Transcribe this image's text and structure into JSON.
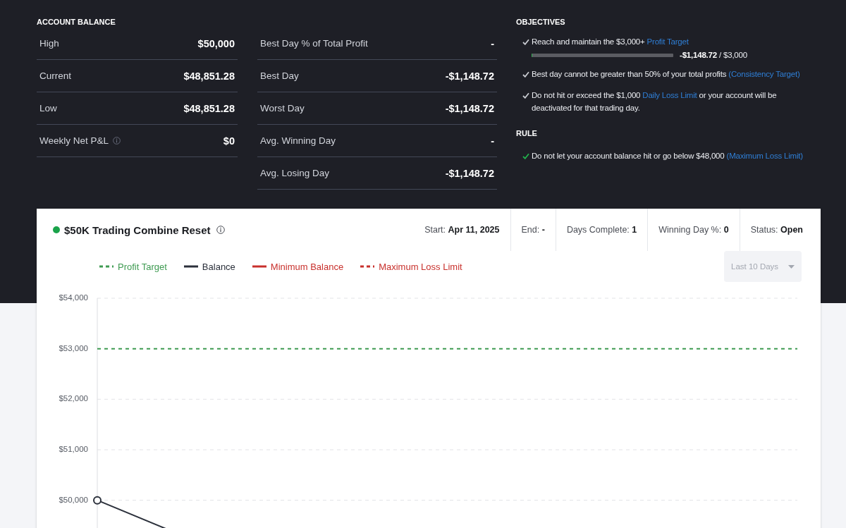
{
  "account_balance": {
    "title": "ACCOUNT BALANCE",
    "columns": [
      [
        {
          "label": "High",
          "value": "$50,000",
          "info_icon": false
        },
        {
          "label": "Current",
          "value": "$48,851.28",
          "info_icon": false
        },
        {
          "label": "Low",
          "value": "$48,851.28",
          "info_icon": false
        },
        {
          "label": "Weekly Net P&L",
          "value": "$0",
          "info_icon": true
        }
      ],
      [
        {
          "label": "Best Day % of Total Profit",
          "value": "-",
          "info_icon": false
        },
        {
          "label": "Best Day",
          "value": "-$1,148.72",
          "info_icon": false
        },
        {
          "label": "Worst Day",
          "value": "-$1,148.72",
          "info_icon": false
        },
        {
          "label": "Avg. Winning Day",
          "value": "-",
          "info_icon": false
        },
        {
          "label": "Avg. Losing Day",
          "value": "-$1,148.72",
          "info_icon": false
        }
      ]
    ]
  },
  "objectives": {
    "title": "OBJECTIVES",
    "items": [
      {
        "text": "Reach and maintain the $3,000+",
        "link": "Profit Target",
        "met": false,
        "progress": {
          "level": 0,
          "reading": "**-$1,148.72** / $3,000"
        }
      },
      {
        "text": "Best day cannot be greater than 50% of your total profits",
        "link": "(Consistency Target)",
        "met": false
      },
      {
        "text": "Do not hit or exceed the $1,000",
        "link": "Daily Loss Limit",
        "after": "or your account will be deactivated for that trading day.",
        "met": false
      }
    ]
  },
  "rule": {
    "title": "RULE",
    "items": [
      {
        "text": "Do not let your account balance hit or go below $48,000",
        "link": "(Maximum Loss Limit)",
        "met": true
      }
    ]
  },
  "combine": {
    "title": "$50K Trading Combine Reset",
    "active": true,
    "stats": [
      {
        "label": "Start:",
        "value": "Apr 11, 2025"
      },
      {
        "label": "End:",
        "value": "-"
      },
      {
        "label": "Days Complete:",
        "value": "1"
      },
      {
        "label": "Winning Day %:",
        "value": "0"
      },
      {
        "label": "Status:",
        "value": "Open"
      }
    ],
    "range_select": {
      "value": "Last 10 Days",
      "disabled": true
    },
    "chart_data": {
      "type": "line",
      "grid": true,
      "categories": [
        null,
        null,
        null,
        null,
        null,
        null
      ],
      "ylim": [
        48000,
        54000
      ],
      "yticks": [
        {
          "value": 50000,
          "label": "$50,000"
        },
        {
          "value": 51000,
          "label": "$51,000"
        },
        {
          "value": 52000,
          "label": "$52,000"
        },
        {
          "value": 53000,
          "label": "$53,000"
        },
        {
          "value": 54000,
          "label": "$54,000"
        }
      ],
      "series": [
        {
          "name": "Profit Target",
          "color": "#3f9b52",
          "line_style": "dashed",
          "values": [
            53000,
            53000,
            53000,
            53000,
            53000,
            53000
          ]
        },
        {
          "name": "Balance",
          "color": "#2b303b",
          "line_style": "solid",
          "values": [
            50000,
            48851.28,
            null,
            null,
            null,
            null
          ]
        },
        {
          "name": "Minimum Balance",
          "color": "#c8302c",
          "line_style": "solid",
          "values": [
            null,
            null,
            null,
            null,
            null,
            null
          ]
        },
        {
          "name": "Maximum Loss Limit",
          "color": "#c8302c",
          "line_style": "dashed",
          "values": [
            null,
            null,
            null,
            null,
            null,
            null
          ]
        }
      ]
    }
  }
}
